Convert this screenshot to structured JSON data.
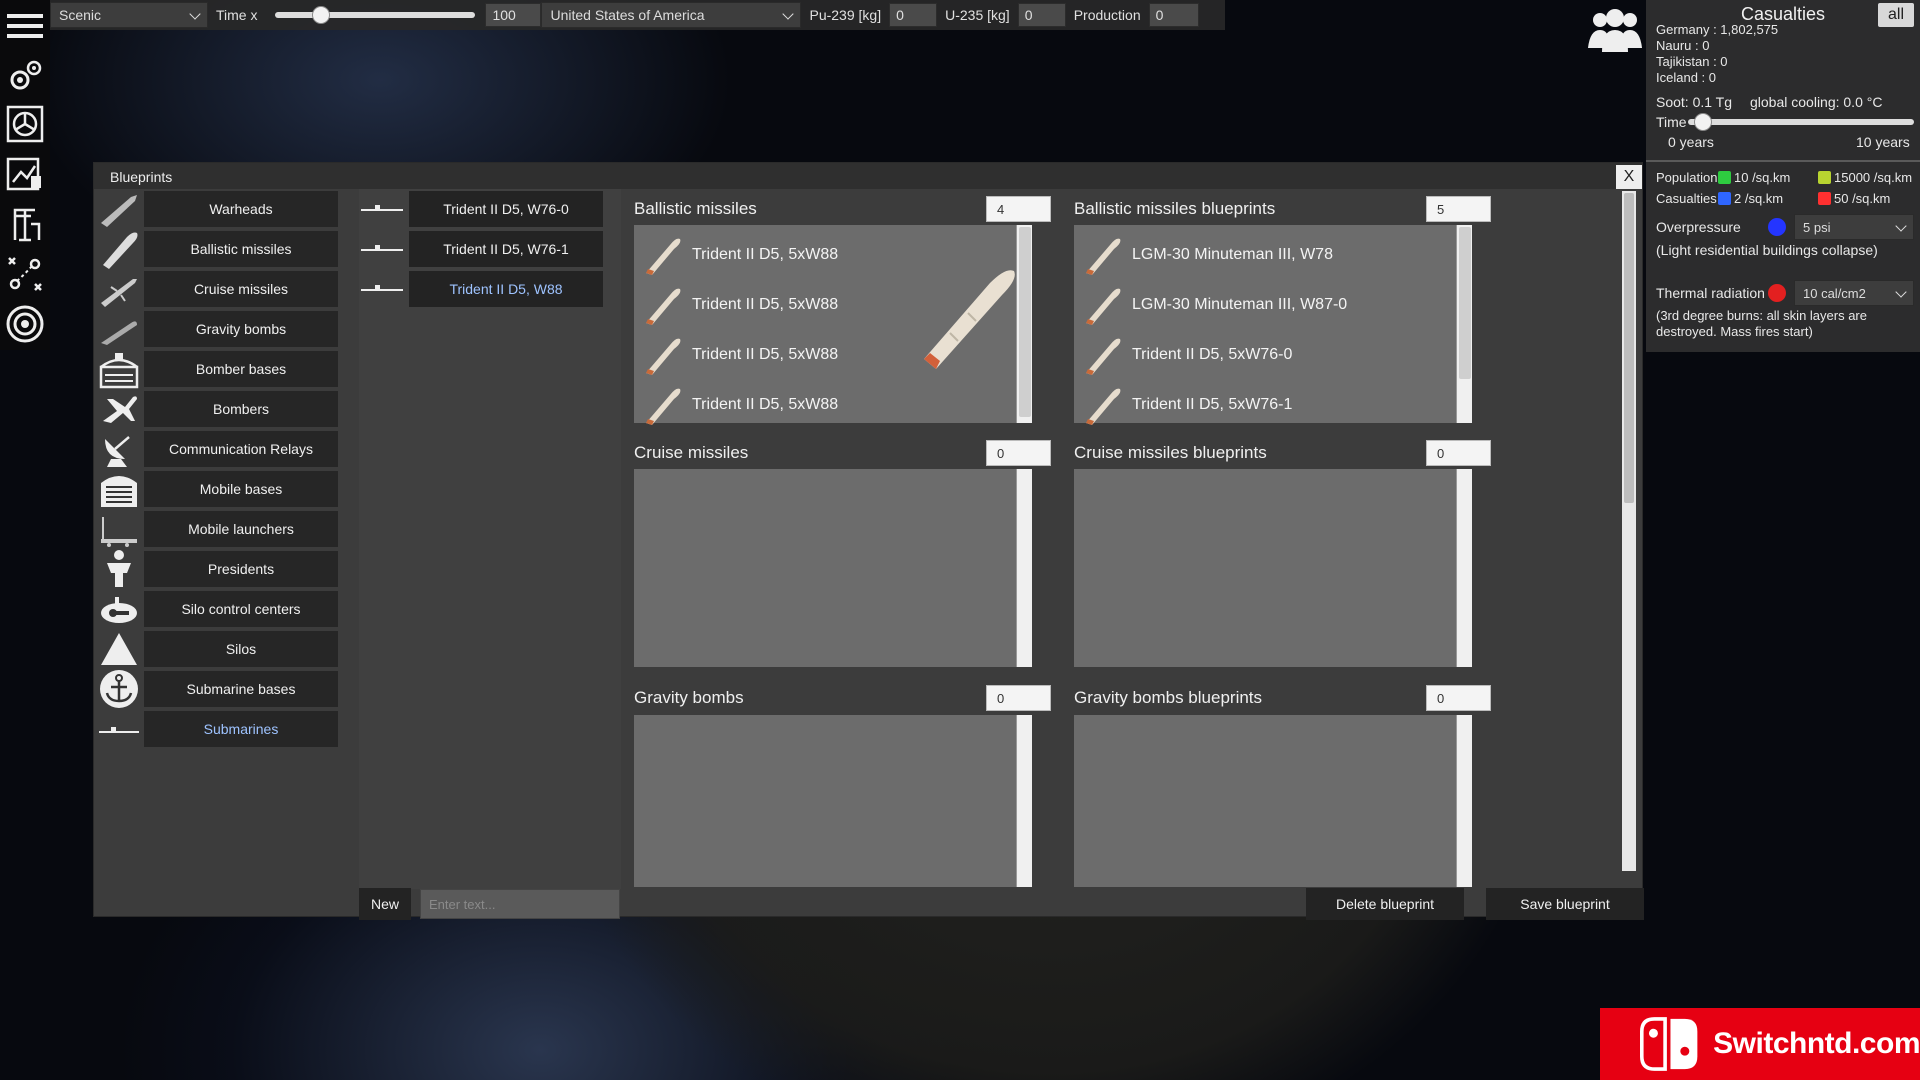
{
  "topbar": {
    "mode": "Scenic",
    "time_label": "Time x",
    "time_value": "100",
    "time_slider_fraction": 0.2,
    "country": "United States of America",
    "pu_label": "Pu-239 [kg]",
    "pu_value": "0",
    "u_label": "U-235 [kg]",
    "u_value": "0",
    "production_label": "Production",
    "production_value": "0"
  },
  "casualties": {
    "title": "Casualties",
    "all_label": "all",
    "countries": [
      "Germany : 1,802,575",
      "Nauru : 0",
      "Tajikistan : 0",
      "Iceland : 0"
    ],
    "soot": "Soot: 0.1 Tg",
    "cooling": "global cooling: 0.0 °C",
    "time_label": "Time",
    "time_slider_fraction": 0.03,
    "time_start": "0 years",
    "time_end": "10 years",
    "population_label": "Population",
    "population_low": "10 /sq.km",
    "population_high": "15000 /sq.km",
    "casualties_label": "Casualties",
    "casualties_low": "2 /sq.km",
    "casualties_high": "50 /sq.km",
    "overpressure_label": "Overpressure",
    "overpressure_value": "5 psi",
    "overpressure_note": "(Light residential buildings collapse)",
    "thermal_label": "Thermal radiation",
    "thermal_value": "10 cal/cm2",
    "thermal_note": "(3rd degree burns: all skin layers are destroyed. Mass fires start)",
    "colors": {
      "pop_low": "#2ecc40",
      "pop_high": "#b8d430",
      "cas_low": "#2f66ff",
      "cas_high": "#ff3030",
      "overpressure": "#2435ff",
      "thermal": "#e32020"
    }
  },
  "window": {
    "title": "Blueprints",
    "close_label": "X",
    "categories": [
      {
        "label": "Warheads",
        "icon": "warhead-icon"
      },
      {
        "label": "Ballistic missiles",
        "icon": "ballistic-missile-icon"
      },
      {
        "label": "Cruise missiles",
        "icon": "cruise-missile-icon"
      },
      {
        "label": "Gravity bombs",
        "icon": "gravity-bomb-icon"
      },
      {
        "label": "Bomber bases",
        "icon": "bomber-base-icon"
      },
      {
        "label": "Bombers",
        "icon": "bomber-icon"
      },
      {
        "label": "Communication Relays",
        "icon": "satellite-dish-icon"
      },
      {
        "label": "Mobile bases",
        "icon": "mobile-base-icon"
      },
      {
        "label": "Mobile launchers",
        "icon": "mobile-launcher-icon"
      },
      {
        "label": "Presidents",
        "icon": "president-icon"
      },
      {
        "label": "Silo control centers",
        "icon": "silo-control-icon"
      },
      {
        "label": "Silos",
        "icon": "silo-icon"
      },
      {
        "label": "Submarine bases",
        "icon": "anchor-icon"
      },
      {
        "label": "Submarines",
        "icon": "submarine-icon"
      }
    ],
    "selected_category": "Submarines",
    "submarine_blueprints": [
      "Trident II D5, W76-0",
      "Trident II D5, W76-1",
      "Trident II D5, W88"
    ],
    "selected_blueprint": "Trident II D5, W88",
    "sections": [
      {
        "title": "Ballistic missiles",
        "count": "4",
        "items": [
          "Trident II D5, 5xW88",
          "Trident II D5, 5xW88",
          "Trident II D5, 5xW88",
          "Trident II D5, 5xW88"
        ],
        "bp_title": "Ballistic missiles blueprints",
        "bp_count": "5",
        "bp_items": [
          "LGM-30 Minuteman III, W78",
          "LGM-30 Minuteman III, W87-0",
          "Trident II D5, 5xW76-0",
          "Trident II D5, 5xW76-1"
        ]
      },
      {
        "title": "Cruise missiles",
        "count": "0",
        "items": [],
        "bp_title": "Cruise missiles blueprints",
        "bp_count": "0",
        "bp_items": []
      },
      {
        "title": "Gravity bombs",
        "count": "0",
        "items": [],
        "bp_title": "Gravity bombs blueprints",
        "bp_count": "0",
        "bp_items": []
      }
    ],
    "new_label": "New",
    "name_placeholder": "Enter text...",
    "delete_label": "Delete blueprint",
    "save_label": "Save blueprint"
  },
  "watermark": {
    "text": "Switchntd.com"
  }
}
